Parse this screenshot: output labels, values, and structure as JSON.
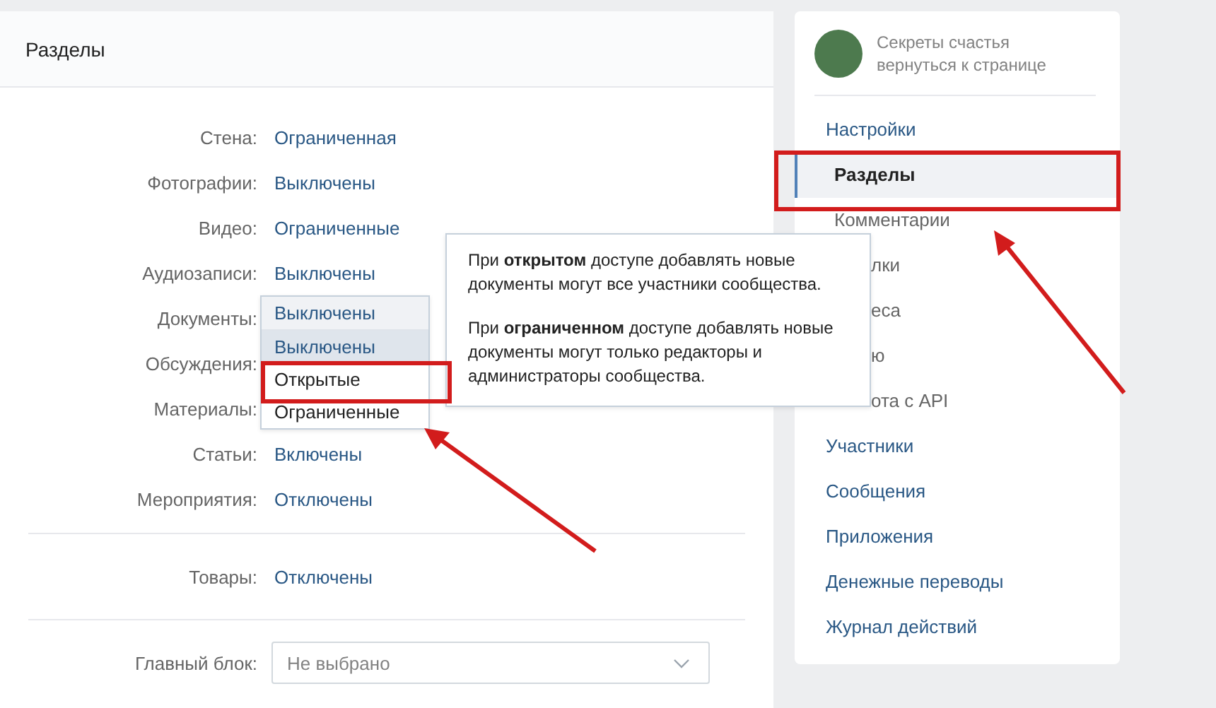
{
  "main": {
    "title": "Разделы",
    "rows": [
      {
        "label": "Стена:",
        "value": "Ограниченная"
      },
      {
        "label": "Фотографии:",
        "value": "Выключены"
      },
      {
        "label": "Видео:",
        "value": "Ограниченные"
      },
      {
        "label": "Аудиозаписи:",
        "value": "Выключены"
      },
      {
        "label": "Документы:",
        "dropdown": true
      },
      {
        "label": "Обсуждения:"
      },
      {
        "label": "Материалы:"
      },
      {
        "label": "Статьи:",
        "value": "Включены"
      },
      {
        "label": "Мероприятия:",
        "value": "Отключены"
      }
    ],
    "goods": {
      "label": "Товары:",
      "value": "Отключены"
    },
    "main_block": {
      "label": "Главный блок:",
      "placeholder": "Не выбрано"
    }
  },
  "dropdown": {
    "current": "Выключены",
    "options": [
      {
        "label": "Выключены",
        "selected": true
      },
      {
        "label": "Открытые",
        "selected": false
      },
      {
        "label": "Ограниченные",
        "selected": false
      }
    ]
  },
  "tooltip": [
    "При **открытом** доступе добавлять новые документы могут все участники сообщества.",
    "При **ограниченном** доступе добавлять новые документы могут только редакторы и администраторы сообщества."
  ],
  "sidebar": {
    "group_name": "Секреты счастья",
    "back_link": "вернуться к странице",
    "items": [
      {
        "label": "Настройки",
        "kind": "top",
        "selected": false
      },
      {
        "label": "Разделы",
        "kind": "sub",
        "selected": true
      },
      {
        "label": "Комментарии",
        "kind": "sub",
        "selected": false
      },
      {
        "label": "лки",
        "kind": "partial",
        "selected": false
      },
      {
        "label": "еса",
        "kind": "partial",
        "selected": false
      },
      {
        "label": "ю",
        "kind": "partial",
        "selected": false
      },
      {
        "label": "ота с API",
        "kind": "partial",
        "selected": false
      },
      {
        "label": "Участники",
        "kind": "top",
        "selected": false
      },
      {
        "label": "Сообщения",
        "kind": "top",
        "selected": false
      },
      {
        "label": "Приложения",
        "kind": "top",
        "selected": false
      },
      {
        "label": "Денежные переводы",
        "kind": "top",
        "selected": false
      },
      {
        "label": "Журнал действий",
        "kind": "top",
        "selected": false
      }
    ]
  }
}
